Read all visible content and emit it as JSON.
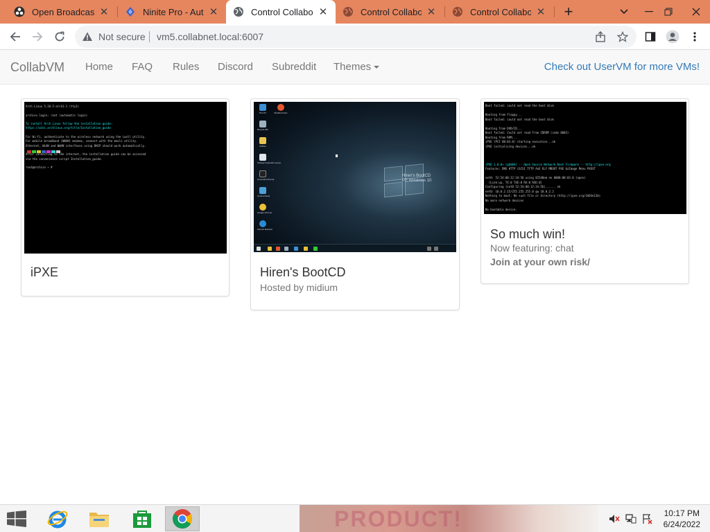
{
  "browser": {
    "tabs": [
      {
        "title": "Open Broadcaster",
        "favicon": "obs-icon",
        "active": false
      },
      {
        "title": "Ninite Pro - Auto",
        "favicon": "ninite-icon",
        "active": false
      },
      {
        "title": "Control Collabora",
        "favicon": "globe-icon",
        "active": true
      },
      {
        "title": "Control Collabora",
        "favicon": "globe-icon",
        "active": false
      },
      {
        "title": "Control Collabora",
        "favicon": "globe-icon",
        "active": false
      }
    ],
    "security_label": "Not secure",
    "url": "vm5.collabnet.local:6007"
  },
  "navbar": {
    "brand": "CollabVM",
    "links": [
      "Home",
      "FAQ",
      "Rules",
      "Discord",
      "Subreddit"
    ],
    "themes_label": "Themes",
    "right_link": "Check out UserVM for more VMs!"
  },
  "vms": [
    {
      "title": "iPXE",
      "screen": [
        "Arch Linux 5.18.5-arch1-1 (tty1)",
        "",
        "archiso login: root (automatic login)",
        "",
        "To install Arch Linux follow the installation guide:",
        "https://wiki.archlinux.org/title/Installation_guide",
        "",
        "For Wi-Fi, authenticate to the wireless network using the iwctl utility.",
        "For mobile broadband (WWAN) modems, connect with the mmcli utility.",
        "Ethernet, WLAN and WWAN interfaces using DHCP should work automatically.",
        "",
        "After connecting to the internet, the installation guide can be accessed",
        "via the convenience script Installation_guide.",
        "",
        "root@archiso ~ #"
      ]
    },
    {
      "title": "Hiren's BootCD",
      "subtitle": "Hosted by midium",
      "desktop_icons": [
        "This PC",
        "Recycle Bin",
        "Utilities",
        "Change Keyboard Layout",
        "Command Prompt",
        "Control Panel",
        "Google Chrome",
        "Internet Explorer"
      ],
      "top_icon": "Mozilla Firefox",
      "wallpaper_text": [
        "Hiren's BootCD",
        "PE Windows 10"
      ]
    },
    {
      "title": "So much win!",
      "subtitle": "Now featuring: chat",
      "note": "Join at your own risk/",
      "screen": [
        "Boot failed: could not read the boot disk",
        "",
        "Booting from Floppy...",
        "Boot failed: could not read the boot disk",
        "",
        "Booting from DVD/CD...",
        "Boot failed: Could not read from CDROM (code 0003)",
        "Booting from ROM...",
        "iPXE (PCI 00:03.0) starting execution...ok",
        "iPXE initialising devices...ok",
        "",
        "",
        "",
        "iPXE 1.0.0+ (g6d04) -- Open Source Network Boot Firmware -- http://ipxe.org",
        "Features: DNS HTTP iSCSI TFTP AoE ELF MBOOT PXE bzImage Menu PXEXT",
        "",
        "net0: 52:54:00:12:34:56 using 82540em on 0000:00:03.0 (open)",
        "  [Link:up, TX:0 TXE:0 RX:0 RXE:0]",
        "Configuring (net0 52:54:00:12:34:56)...... ok",
        "net0: 10.0.2.15/255.255.255.0 gw 10.0.2.2",
        "Nothing to boot: No such file or directory (http://ipxe.org/2d03e13b)",
        "No more network devices",
        "",
        "No bootable device."
      ]
    }
  ],
  "taskbar": {
    "apps": [
      "internet-explorer-icon",
      "file-explorer-icon",
      "store-icon",
      "chrome-icon"
    ],
    "wallpaper_text": "PRODUCT!",
    "time": "10:17 PM",
    "date": "6/24/2022"
  },
  "colors": {
    "tabstrip": "#e6865f",
    "link": "#337ab7",
    "navbar_bg": "#f8f8f8",
    "terminal_cyan": "#22eeee"
  }
}
